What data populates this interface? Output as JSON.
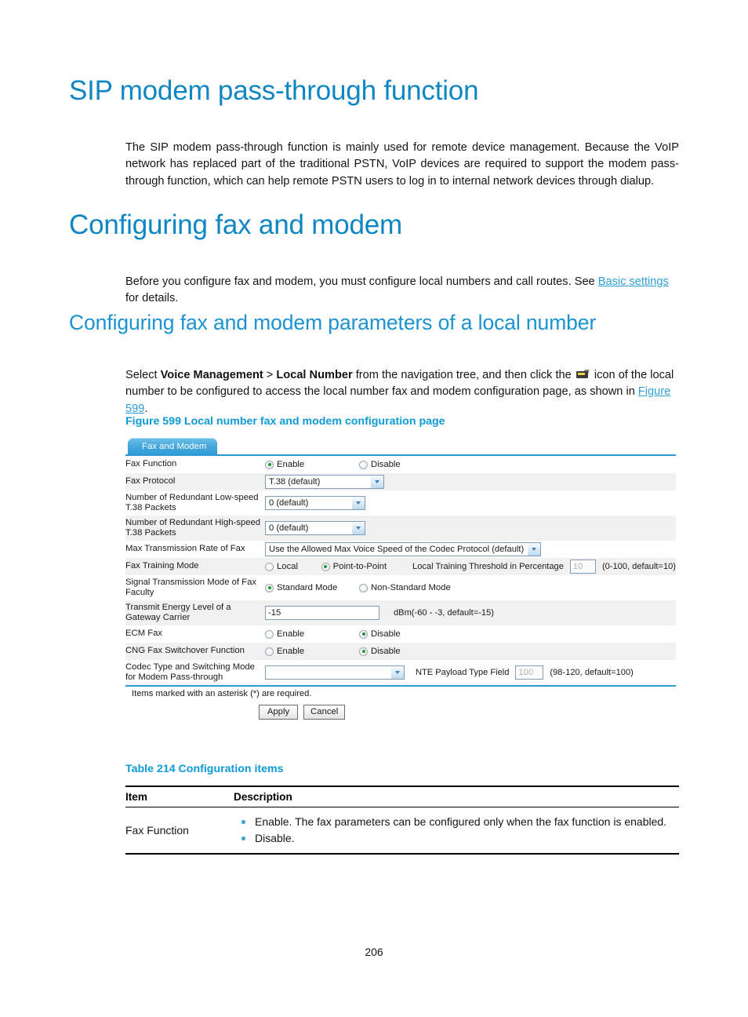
{
  "page": {
    "number": "206"
  },
  "sections": {
    "h1_sip": "SIP modem pass-through function",
    "p_sip_a": "The SIP modem pass-through function is mainly used for remote device management. Because the VoIP network has replaced part of the traditional PSTN, VoIP devices are required to support the modem pass-through function, which can help remote PSTN users to log in to internal network devices through dialup.",
    "h1_config": "Configuring fax and modem",
    "p_config_a": "Before you configure fax and modem, you must configure local numbers and call routes. See ",
    "p_config_link": "Basic settings",
    "p_config_b": " for details.",
    "h2_params": "Configuring fax and modem parameters of a local number",
    "p_select_a": "Select ",
    "p_select_b1": "Voice Management",
    "p_select_c": " > ",
    "p_select_b2": "Local Number",
    "p_select_d": " from the navigation tree, and then click the ",
    "p_select_e": " icon of the local number to be configured to access the local number fax and modem configuration page, as shown in ",
    "p_select_link": "Figure 599",
    "p_select_f": "."
  },
  "figure": {
    "caption": "Figure 599 Local number fax and modem configuration page"
  },
  "screenshot": {
    "tab_label": "Fax and Modem",
    "rows": {
      "fax_function": {
        "label": "Fax Function",
        "opt_enable": "Enable",
        "opt_disable": "Disable",
        "selected": "Enable"
      },
      "fax_protocol": {
        "label": "Fax Protocol",
        "value": "T.38 (default)"
      },
      "redundant_low": {
        "label": "Number of Redundant Low-speed T.38 Packets",
        "value": "0 (default)"
      },
      "redundant_high": {
        "label": "Number of Redundant High-speed T.38 Packets",
        "value": "0 (default)"
      },
      "max_rate": {
        "label": "Max Transmission Rate of Fax",
        "value": "Use the Allowed Max Voice Speed of the Codec Protocol (default)"
      },
      "training_mode": {
        "label": "Fax Training Mode",
        "opt_local": "Local",
        "opt_p2p": "Point-to-Point",
        "selected": "Point-to-Point",
        "threshold_label": "Local Training Threshold in Percentage",
        "threshold_value": "10",
        "threshold_hint": "(0-100, default=10)"
      },
      "signal_mode": {
        "label": "Signal Transmission Mode of Fax Faculty",
        "opt_standard": "Standard Mode",
        "opt_nonstandard": "Non-Standard Mode",
        "selected": "Standard Mode"
      },
      "transmit_energy": {
        "label": "Transmit Energy Level of a Gateway Carrier",
        "value": "-15",
        "hint": "dBm(-60 - -3, default=-15)"
      },
      "ecm_fax": {
        "label": "ECM Fax",
        "opt_enable": "Enable",
        "opt_disable": "Disable",
        "selected": "Disable"
      },
      "cng_switchover": {
        "label": "CNG Fax Switchover Function",
        "opt_enable": "Enable",
        "opt_disable": "Disable",
        "selected": "Disable"
      },
      "codec_modem": {
        "label": "Codec Type and Switching Mode for Modem Pass-through",
        "value": "",
        "nte_label": "NTE Payload Type Field",
        "nte_value": "100",
        "nte_hint": "(98-120, default=100)"
      }
    },
    "required_note": "Items marked with an asterisk (*) are required.",
    "apply_label": "Apply",
    "cancel_label": "Cancel"
  },
  "table214": {
    "caption": "Table 214 Configuration items",
    "headers": [
      "Item",
      "Description"
    ],
    "rows": [
      {
        "item": "Fax Function",
        "bullets": [
          "Enable. The fax parameters can be configured only when the fax function is enabled.",
          "Disable."
        ]
      }
    ]
  },
  "colors": {
    "heading_blue": "#0e86c4",
    "link_blue": "#2f9fd8",
    "caption_blue": "#0e9ad6",
    "tab_blue": "#2e9ad4",
    "radio_green": "#1f9a32",
    "bullet_blue": "#3aa4dc"
  }
}
